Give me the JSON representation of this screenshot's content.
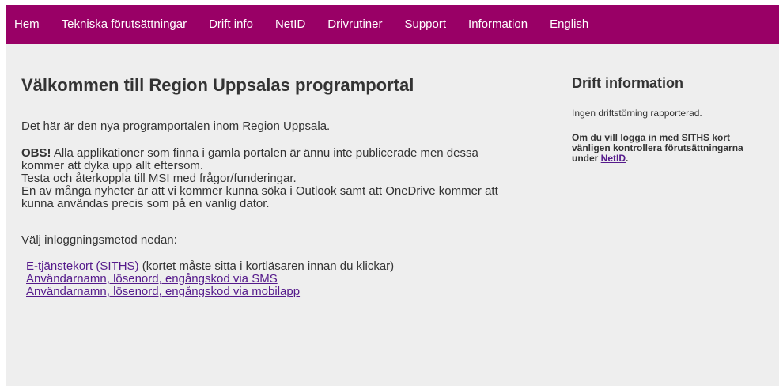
{
  "nav": {
    "items": [
      {
        "label": "Hem"
      },
      {
        "label": "Tekniska förutsättningar"
      },
      {
        "label": "Drift info"
      },
      {
        "label": "NetID"
      },
      {
        "label": "Drivrutiner"
      },
      {
        "label": "Support"
      },
      {
        "label": "Information"
      },
      {
        "label": "English"
      }
    ]
  },
  "main": {
    "title": "Välkommen till Region Uppsalas programportal",
    "intro": "Det här är den nya programportalen inom Region Uppsala.",
    "notice": {
      "obs": "OBS!",
      "line1_rest": " Alla applikationer som finna i gamla portalen är ännu inte publicerade men dessa",
      "line2": "kommer att dyka upp allt eftersom.",
      "line3": "Testa och återkoppla till MSI med frågor/funderingar.",
      "line4": "En av många nyheter är att vi kommer kunna söka i Outlook samt att OneDrive kommer att",
      "line5": "kunna användas precis som på en vanlig dator."
    },
    "choose_label": "Välj inloggningsmetod nedan:",
    "logins": {
      "siths_link": "E-tjänstekort (SITHS)",
      "siths_note": " (kortet måste sitta i kortläsaren innan du klickar)",
      "sms_link": "Användarnamn, lösenord, engångskod via SMS",
      "app_link": "Användarnamn, lösenord, engångskod via mobilapp"
    }
  },
  "side": {
    "title": "Drift information",
    "status": "Ingen driftstörning rapporterad.",
    "siths": {
      "line1": "Om du vill logga in med SITHS kort",
      "line2": "vänligen kontrollera förutsättningarna",
      "line3_prefix": "under ",
      "netid_link": "NetID",
      "line3_suffix": "."
    }
  },
  "colors": {
    "nav_bg": "#990066",
    "page_bg": "#eeeeee",
    "link": "#551a8b",
    "text": "#333333"
  }
}
